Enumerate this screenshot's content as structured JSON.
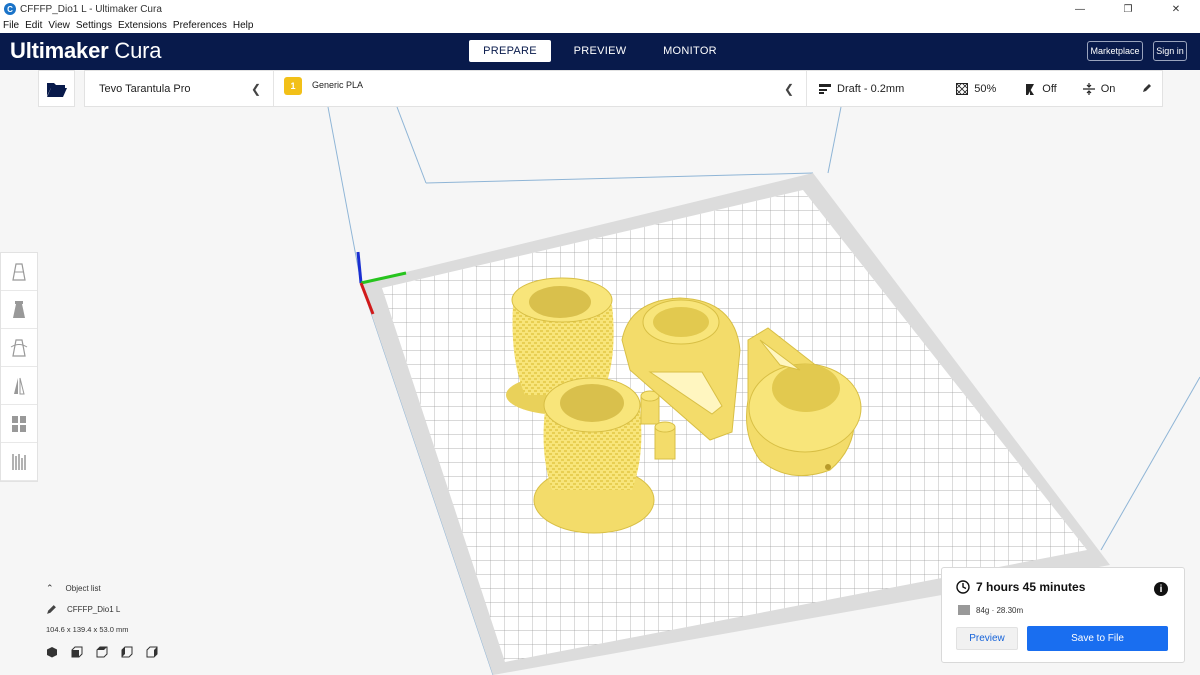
{
  "window": {
    "title": "CFFFP_Dio1 L - Ultimaker Cura",
    "minimize": "—",
    "restore": "❐",
    "close": "✕"
  },
  "menu": [
    "File",
    "Edit",
    "View",
    "Settings",
    "Extensions",
    "Preferences",
    "Help"
  ],
  "header": {
    "brand_bold": "Ultimaker",
    "brand_light": "Cura",
    "tabs": [
      "PREPARE",
      "PREVIEW",
      "MONITOR"
    ],
    "marketplace": "Marketplace",
    "signin": "Sign in"
  },
  "toolbar": {
    "printer": "Tevo Tarantula Pro",
    "material_badge": "1",
    "material": "Generic PLA",
    "profile": "Draft - 0.2mm",
    "infill": "50%",
    "support": "Off",
    "adhesion": "On"
  },
  "object_list": {
    "label": "Object list",
    "name": "CFFFP_Dio1 L",
    "dimensions": "104.6 x 139.4 x 53.0 mm"
  },
  "summary": {
    "time": "7 hours 45 minutes",
    "material_usage": "84g · 28.30m",
    "preview_button": "Preview",
    "save_button": "Save to File"
  },
  "colors": {
    "header_bg": "#081a4b",
    "accent": "#196ef0",
    "model": "#f8e57a",
    "material_badge": "#f2c018"
  }
}
